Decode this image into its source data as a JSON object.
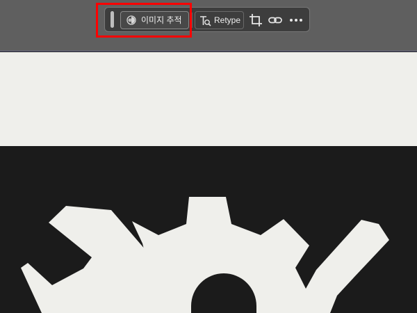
{
  "toolbar": {
    "trace_label": "이미지 추적",
    "retype_label": "Retype"
  },
  "icons": {
    "grip": "drag-handle-icon",
    "trace": "image-trace-icon",
    "retype": "retype-icon",
    "crop": "crop-icon",
    "link": "link-icon",
    "more": "more-icon"
  },
  "colors": {
    "highlight": "#ff0000",
    "artwork": "#efefeb",
    "background": "#1b1b1b"
  }
}
